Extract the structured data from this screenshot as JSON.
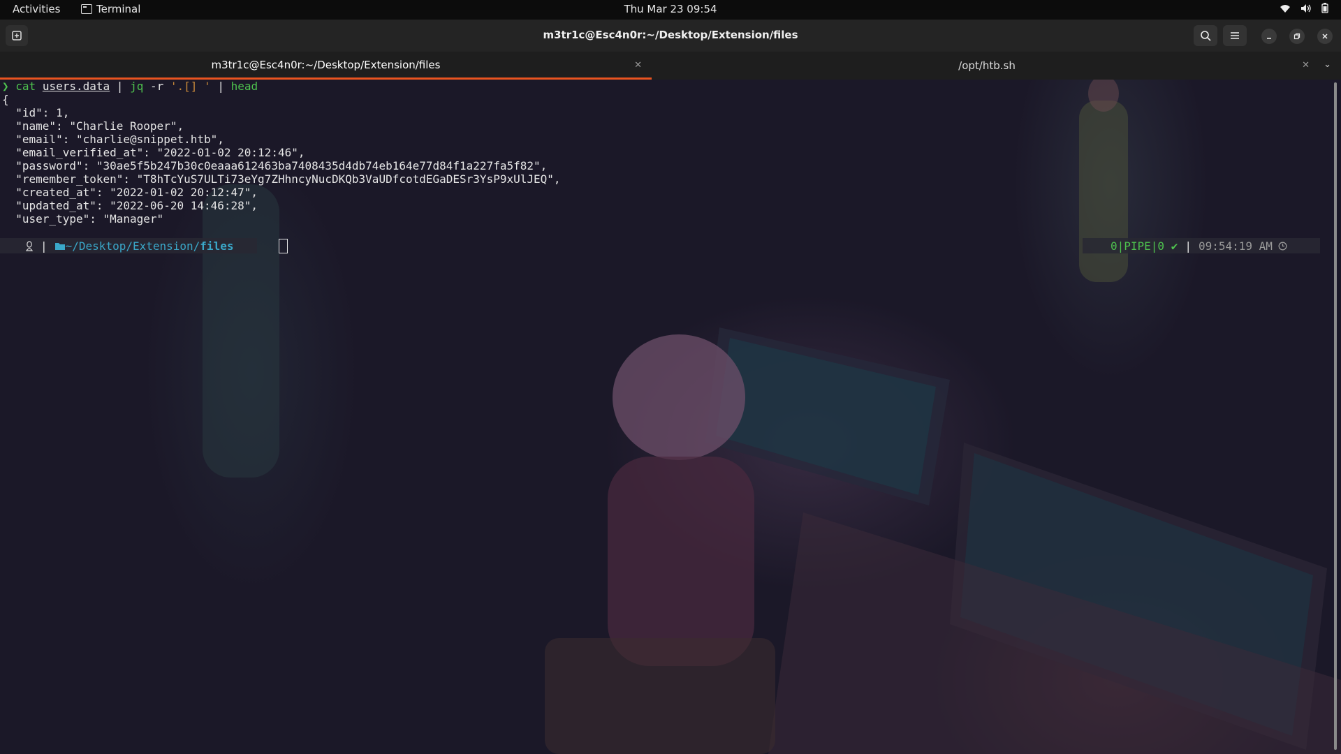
{
  "topbar": {
    "activities": "Activities",
    "app_name": "Terminal",
    "clock": "Thu Mar 23  09:54"
  },
  "window": {
    "title": "m3tr1c@Esc4n0r:~/Desktop/Extension/files"
  },
  "tabs": [
    {
      "label": "m3tr1c@Esc4n0r:~/Desktop/Extension/files",
      "active": true
    },
    {
      "label": "/opt/htb.sh",
      "active": false
    }
  ],
  "terminal": {
    "command": {
      "prompt_symbol": "❯",
      "cmd": "cat",
      "file": "users.data",
      "pipe1": "|",
      "jq": "jq",
      "flag": "-r",
      "filter": "'.[] '",
      "pipe2": "|",
      "head": "head"
    },
    "output": [
      "{",
      "  \"id\": 1,",
      "  \"name\": \"Charlie Rooper\",",
      "  \"email\": \"charlie@snippet.htb\",",
      "  \"email_verified_at\": \"2022-01-02 20:12:46\",",
      "  \"password\": \"30ae5f5b247b30c0eaaa612463ba7408435d4db74eb164e77d84f1a227fa5f82\",",
      "  \"remember_token\": \"T8hTcYuS7ULTi73eYg7ZHhncyNucDKQb3VaUDfcotdEGaDESr3YsP9xUlJEQ\",",
      "  \"created_at\": \"2022-01-02 20:12:47\",",
      "  \"updated_at\": \"2022-06-20 14:46:28\",",
      "  \"user_type\": \"Manager\""
    ],
    "prompt": {
      "separator": "|",
      "path_prefix": "~/Desktop/Extension/",
      "path_current": "files",
      "status": "0|PIPE|0 ✔",
      "status_separator": "|",
      "time": "09:54:19 AM"
    }
  },
  "colors": {
    "accent": "#e95420",
    "prompt_green": "#4ec24e",
    "path_cyan": "#3aa8c9"
  }
}
